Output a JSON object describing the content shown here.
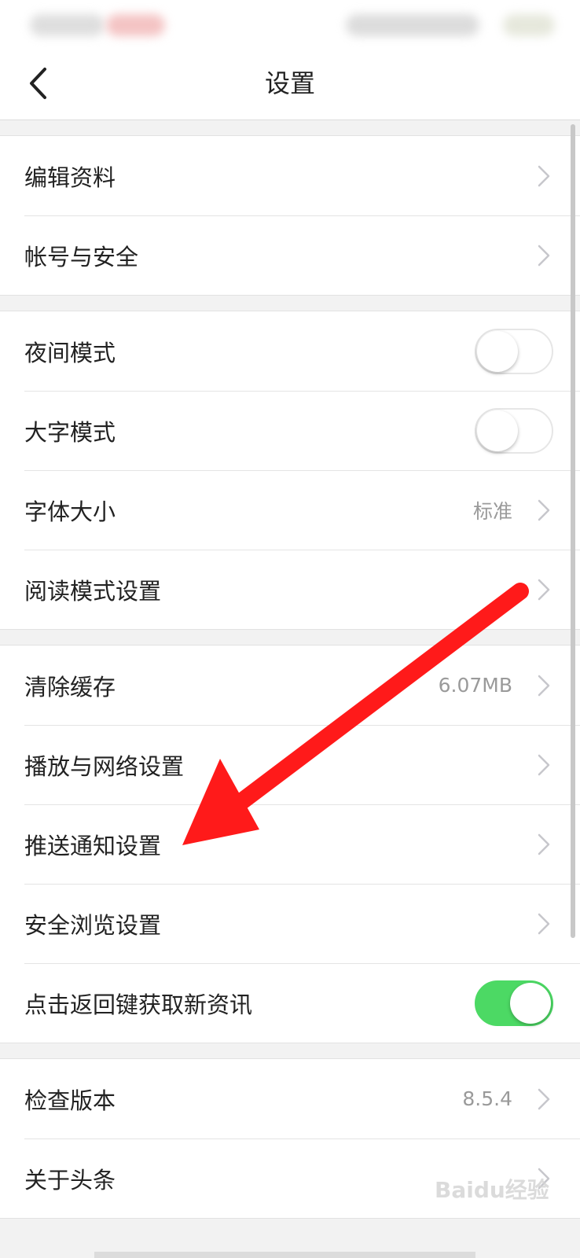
{
  "nav": {
    "title": "设置"
  },
  "groups": [
    {
      "rows": [
        {
          "label": "编辑资料",
          "type": "link"
        },
        {
          "label": "帐号与安全",
          "type": "link"
        }
      ]
    },
    {
      "rows": [
        {
          "label": "夜间模式",
          "type": "toggle",
          "on": false
        },
        {
          "label": "大字模式",
          "type": "toggle",
          "on": false
        },
        {
          "label": "字体大小",
          "type": "link",
          "value": "标准"
        },
        {
          "label": "阅读模式设置",
          "type": "link"
        }
      ]
    },
    {
      "rows": [
        {
          "label": "清除缓存",
          "type": "link",
          "value": "6.07MB"
        },
        {
          "label": "播放与网络设置",
          "type": "link"
        },
        {
          "label": "推送通知设置",
          "type": "link"
        },
        {
          "label": "安全浏览设置",
          "type": "link"
        },
        {
          "label": "点击返回键获取新资讯",
          "type": "toggle",
          "on": true
        }
      ]
    },
    {
      "rows": [
        {
          "label": "检查版本",
          "type": "link",
          "value": "8.5.4"
        },
        {
          "label": "关于头条",
          "type": "link"
        }
      ]
    }
  ],
  "watermark": {
    "text": "Baidu经验"
  },
  "colors": {
    "toggle_on": "#4cd964",
    "annotation_arrow": "#ff1a1a",
    "chevron": "#c7c7cc"
  },
  "icons": {
    "back": "chevron-left-icon",
    "row_arrow": "chevron-right-icon"
  }
}
